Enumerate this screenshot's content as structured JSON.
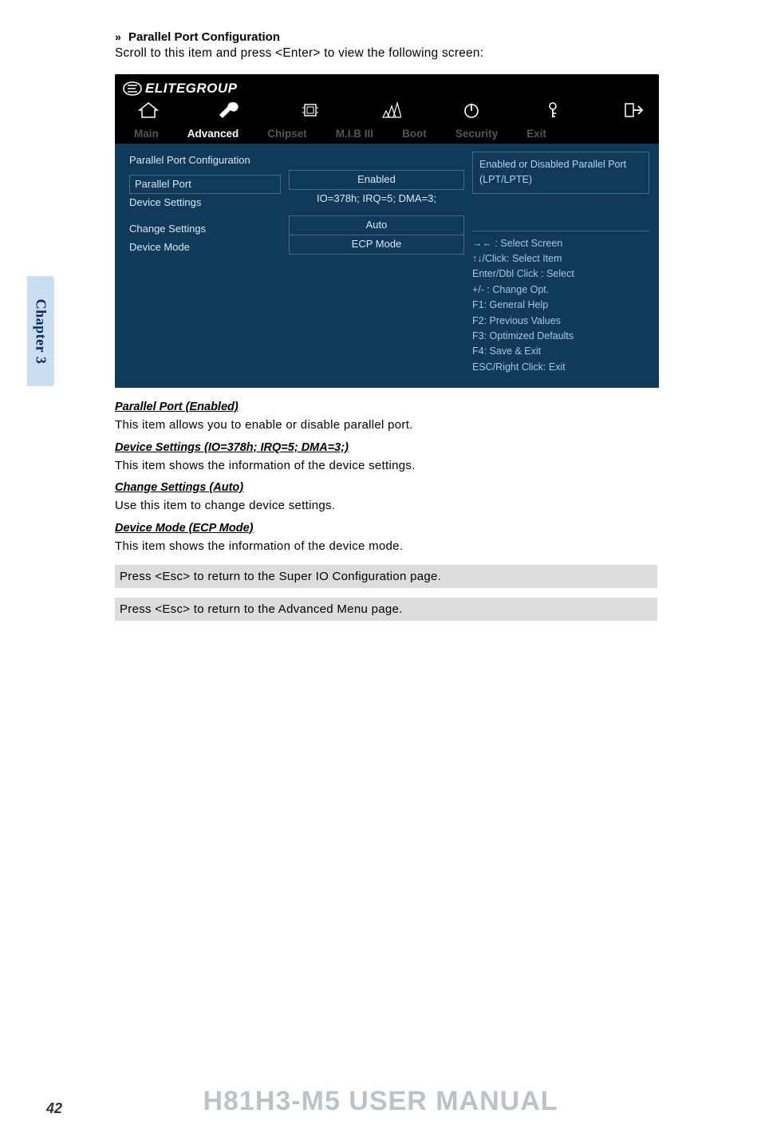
{
  "page": {
    "section_prefix": "»",
    "section_title": "Parallel Port Configuration",
    "intro_text": "Scroll to this item and press <Enter> to view the following screen:"
  },
  "bios": {
    "logo": "ELITEGROUP",
    "tabs": {
      "main": "Main",
      "advanced": "Advanced",
      "chipset": "Chipset",
      "mib": "M.I.B III",
      "boot": "Boot",
      "security": "Security",
      "exit": "Exit"
    },
    "left": {
      "heading": "Parallel Port Configuration",
      "items": {
        "parallel_port": "Parallel Port",
        "device_settings": "Device Settings",
        "change_settings": "Change Settings",
        "device_mode": "Device Mode"
      }
    },
    "center": {
      "parallel_port_value": "Enabled",
      "device_settings_value": "IO=378h; IRQ=5; DMA=3;",
      "change_settings_value": "Auto",
      "device_mode_value": "ECP Mode"
    },
    "help": {
      "box_text": "Enabled or Disabled Parallel Port (LPT/LPTE)",
      "hints": {
        "l1": "→←    : Select Screen",
        "l2": "↑↓/Click: Select Item",
        "l3": "Enter/Dbl Click : Select",
        "l4": "+/- : Change Opt.",
        "l5": "F1: General Help",
        "l6": "F2: Previous Values",
        "l7": "F3: Optimized Defaults",
        "l8": "F4: Save & Exit",
        "l9": "ESC/Right Click: Exit"
      }
    }
  },
  "descriptions": {
    "h1": "Parallel Port (Enabled)",
    "p1": "This item allows you to enable or disable parallel port.",
    "h2": "Device Settings (IO=378h; IRQ=5; DMA=3;)",
    "p2": "This item shows the information of the device settings.",
    "h3": "Change Settings (Auto)",
    "p3": "Use this item to change device settings.",
    "h4": "Device Mode (ECP Mode)",
    "p4": "This item shows the information of the device mode.",
    "gray1": "Press <Esc> to return to the Super IO Configuration page.",
    "gray2": "Press <Esc> to return to the Advanced Menu page."
  },
  "sidebar": {
    "chapter": "Chapter 3"
  },
  "footer": {
    "title": "H81H3-M5 USER MANUAL",
    "page": "42"
  }
}
